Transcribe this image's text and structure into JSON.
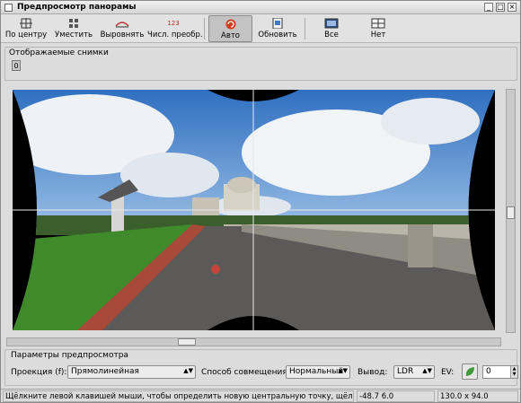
{
  "window": {
    "title": "Предпросмотр панорамы"
  },
  "toolbar": {
    "center": "По центру",
    "fit": "Уместить",
    "straighten": "Выровнять",
    "num_transform": "Числ. преобр.",
    "num_transform_badge": "123",
    "auto": "Авто",
    "update": "Обновить",
    "all": "Все",
    "none": "Нет"
  },
  "displayed_images": {
    "title": "Отображаемые снимки",
    "items": [
      "0"
    ]
  },
  "preview_params": {
    "title": "Параметры предпросмотра",
    "projection_label": "Проекция (f):",
    "projection_value": "Прямолинейная",
    "blend_label": "Способ совмещения:",
    "blend_value": "Нормальный",
    "output_label": "Вывод:",
    "output_value": "LDR",
    "ev_label": "EV:",
    "ev_value": "0"
  },
  "status": {
    "hint": "Щёлкните левой клавишей мыши, чтобы определить новую центральную точку, щёлкните",
    "coords": "-48.7 6.0",
    "fov": "130.0 x 94.0"
  },
  "colors": {
    "accent": "#d03b1b",
    "sky": "#3d7bc4",
    "grass": "#3f8a2b"
  }
}
